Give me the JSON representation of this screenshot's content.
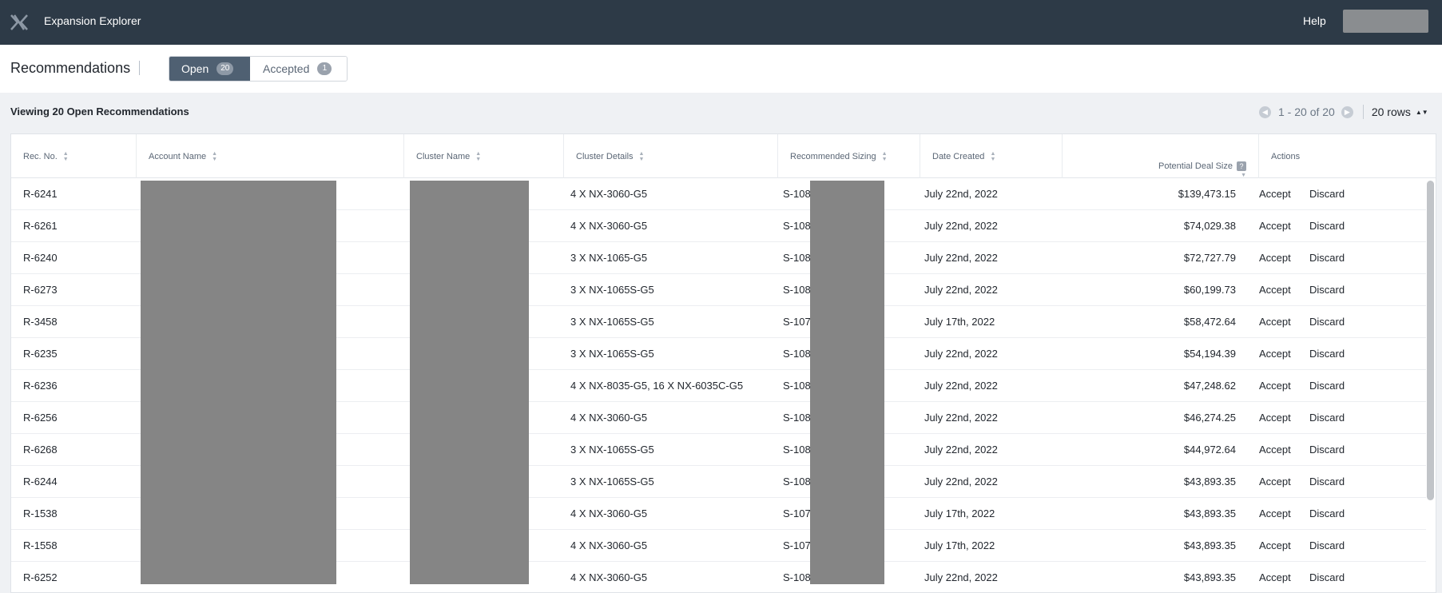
{
  "app": {
    "title": "Expansion Explorer",
    "help_label": "Help"
  },
  "page": {
    "title": "Recommendations",
    "tabs": [
      {
        "label": "Open",
        "count": "20"
      },
      {
        "label": "Accepted",
        "count": "1"
      }
    ],
    "viewing_text": "Viewing 20 Open Recommendations"
  },
  "pager": {
    "range": "1 - 20 of 20",
    "rows_label": "20 rows"
  },
  "table": {
    "columns": {
      "rec_no": "Rec. No.",
      "account_name": "Account Name",
      "cluster_name": "Cluster Name",
      "cluster_details": "Cluster Details",
      "recommended_sizing": "Recommended Sizing",
      "date_created": "Date Created",
      "potential_deal_size": "Potential Deal Size",
      "actions": "Actions"
    },
    "rows": [
      {
        "rec_no": "R-6241",
        "details": "4 X NX-3060-G5",
        "sizing": "S-108",
        "date": "July 22nd, 2022",
        "deal": "$139,473.15"
      },
      {
        "rec_no": "R-6261",
        "details": "4 X NX-3060-G5",
        "sizing": "S-108",
        "date": "July 22nd, 2022",
        "deal": "$74,029.38"
      },
      {
        "rec_no": "R-6240",
        "details": "3 X NX-1065-G5",
        "sizing": "S-108",
        "date": "July 22nd, 2022",
        "deal": "$72,727.79"
      },
      {
        "rec_no": "R-6273",
        "details": "3 X NX-1065S-G5",
        "sizing": "S-108",
        "date": "July 22nd, 2022",
        "deal": "$60,199.73"
      },
      {
        "rec_no": "R-3458",
        "details": "3 X NX-1065S-G5",
        "sizing": "S-107",
        "date": "July 17th, 2022",
        "deal": "$58,472.64"
      },
      {
        "rec_no": "R-6235",
        "details": "3 X NX-1065S-G5",
        "sizing": "S-108",
        "date": "July 22nd, 2022",
        "deal": "$54,194.39"
      },
      {
        "rec_no": "R-6236",
        "details": "4 X NX-8035-G5, 16 X NX-6035C-G5",
        "sizing": "S-108",
        "date": "July 22nd, 2022",
        "deal": "$47,248.62"
      },
      {
        "rec_no": "R-6256",
        "details": "4 X NX-3060-G5",
        "sizing": "S-108",
        "date": "July 22nd, 2022",
        "deal": "$46,274.25"
      },
      {
        "rec_no": "R-6268",
        "details": "3 X NX-1065S-G5",
        "sizing": "S-108",
        "date": "July 22nd, 2022",
        "deal": "$44,972.64"
      },
      {
        "rec_no": "R-6244",
        "details": "3 X NX-1065S-G5",
        "sizing": "S-108",
        "date": "July 22nd, 2022",
        "deal": "$43,893.35"
      },
      {
        "rec_no": "R-1538",
        "details": "4 X NX-3060-G5",
        "sizing": "S-107",
        "date": "July 17th, 2022",
        "deal": "$43,893.35"
      },
      {
        "rec_no": "R-1558",
        "details": "4 X NX-3060-G5",
        "sizing": "S-107",
        "date": "July 17th, 2022",
        "deal": "$43,893.35"
      },
      {
        "rec_no": "R-6252",
        "details": "4 X NX-3060-G5",
        "sizing": "S-108",
        "date": "July 22nd, 2022",
        "deal": "$43,893.35"
      }
    ],
    "accept_label": "Accept",
    "discard_label": "Discard"
  },
  "icons": {
    "logo": "x-logo-icon",
    "sort": "sort-icon",
    "help": "question-icon",
    "prev": "chevron-left-icon",
    "next": "chevron-right-icon"
  },
  "colors": {
    "topbar": "#2d3a47",
    "active_tab": "#4f6072",
    "redaction": "#858585"
  }
}
